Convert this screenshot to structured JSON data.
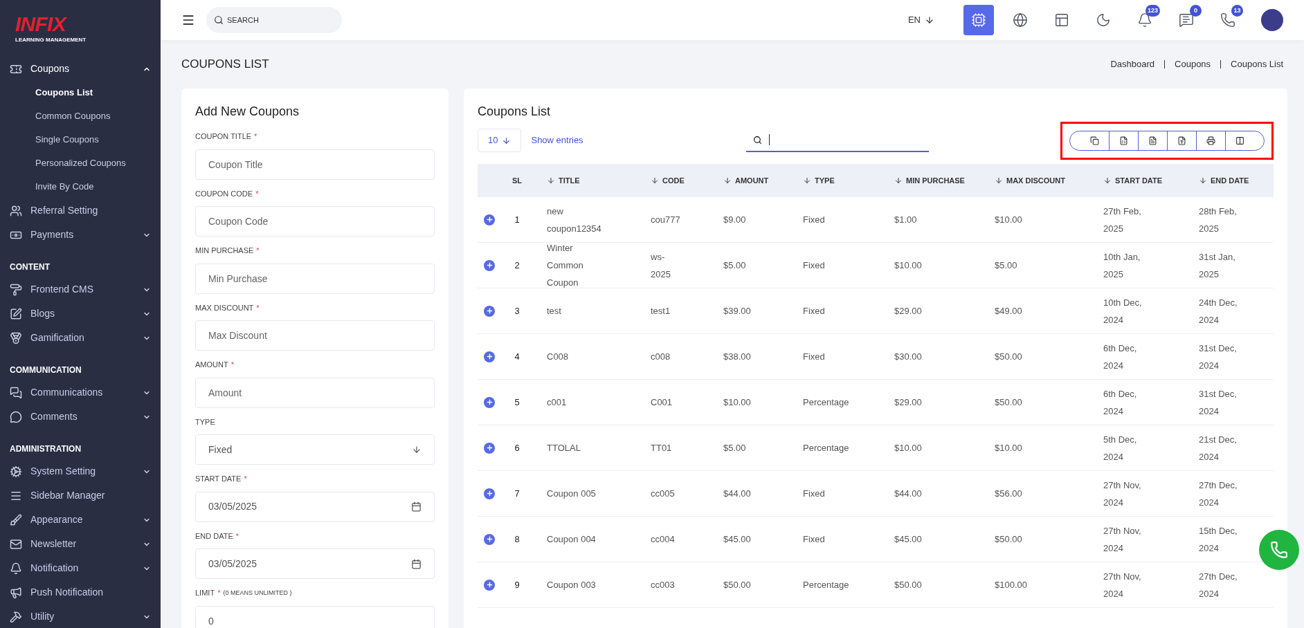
{
  "logo": {
    "brand": "INFIX",
    "tagline": "LEARNING MANAGEMENT"
  },
  "sidebar": {
    "items": [
      {
        "kind": "item",
        "label": "Coupons",
        "caret": true,
        "expanded": true,
        "children": [
          {
            "label": "Coupons List",
            "selected": true
          },
          {
            "label": "Common Coupons",
            "selected": false
          },
          {
            "label": "Single Coupons",
            "selected": false
          },
          {
            "label": "Personalized Coupons",
            "selected": false
          },
          {
            "label": "Invite By Code",
            "selected": false
          }
        ]
      },
      {
        "kind": "item",
        "label": "Referral Setting",
        "caret": false,
        "expanded": false
      },
      {
        "kind": "item",
        "label": "Payments",
        "caret": true,
        "expanded": false
      },
      {
        "kind": "heading",
        "label": "CONTENT"
      },
      {
        "kind": "item",
        "label": "Frontend CMS",
        "caret": true,
        "expanded": false
      },
      {
        "kind": "item",
        "label": "Blogs",
        "caret": true,
        "expanded": false
      },
      {
        "kind": "item",
        "label": "Gamification",
        "caret": true,
        "expanded": false
      },
      {
        "kind": "heading",
        "label": "COMMUNICATION"
      },
      {
        "kind": "item",
        "label": "Communications",
        "caret": true,
        "expanded": false
      },
      {
        "kind": "item",
        "label": "Comments",
        "caret": true,
        "expanded": false
      },
      {
        "kind": "heading",
        "label": "ADMINISTRATION"
      },
      {
        "kind": "item",
        "label": "System Setting",
        "caret": true,
        "expanded": false
      },
      {
        "kind": "item",
        "label": "Sidebar Manager",
        "caret": false,
        "expanded": false
      },
      {
        "kind": "item",
        "label": "Appearance",
        "caret": true,
        "expanded": false
      },
      {
        "kind": "item",
        "label": "Newsletter",
        "caret": true,
        "expanded": false
      },
      {
        "kind": "item",
        "label": "Notification",
        "caret": true,
        "expanded": false
      },
      {
        "kind": "item",
        "label": "Push Notification",
        "caret": false,
        "expanded": false
      },
      {
        "kind": "item",
        "label": "Utility",
        "caret": true,
        "expanded": false
      }
    ]
  },
  "topbar": {
    "search": {
      "placeholder": "SEARCH"
    },
    "language": "EN",
    "actions": [
      {
        "kind": "ai",
        "selected": true
      },
      {
        "kind": "globe",
        "selected": false
      },
      {
        "kind": "layout",
        "selected": false
      },
      {
        "kind": "theme",
        "selected": false
      },
      {
        "kind": "notifications",
        "selected": false,
        "badge": "123"
      },
      {
        "kind": "messages",
        "selected": false,
        "badge": "0"
      },
      {
        "kind": "chat",
        "selected": false,
        "badge": "13"
      }
    ]
  },
  "page": {
    "title": "COUPONS LIST",
    "breadcrumb": [
      "Dashboard",
      "Coupons",
      "Coupons List"
    ]
  },
  "form": {
    "title": "Add New Coupons",
    "fields": [
      {
        "kind": "text",
        "label": "COUPON TITLE",
        "required_mark": "*",
        "placeholder": "Coupon Title"
      },
      {
        "kind": "text",
        "label": "COUPON CODE",
        "required_mark": "*",
        "placeholder": "Coupon Code"
      },
      {
        "kind": "text",
        "label": "MIN PURCHASE",
        "required_mark": "*",
        "placeholder": "Min Purchase"
      },
      {
        "kind": "text",
        "label": "MAX DISCOUNT",
        "required_mark": "*",
        "placeholder": "Max Discount"
      },
      {
        "kind": "text",
        "label": "AMOUNT",
        "required_mark": "*",
        "placeholder": "Amount"
      },
      {
        "kind": "select",
        "label": "TYPE",
        "value": "Fixed"
      },
      {
        "kind": "date",
        "label": "START DATE",
        "required_mark": "*",
        "value": "03/05/2025"
      },
      {
        "kind": "date",
        "label": "END DATE",
        "required_mark": "*",
        "value": "03/05/2025"
      },
      {
        "kind": "text",
        "label": "LIMIT",
        "required_mark": "*",
        "note": "(0 MEANS UNLIMITED )",
        "value": "0"
      }
    ]
  },
  "list": {
    "title": "Coupons List",
    "page_size": "10",
    "show_entries": "Show entries",
    "export_toolbar": {
      "highlighted": true
    },
    "table": {
      "columns": [
        {
          "label": "SL",
          "sortable": false
        },
        {
          "label": "TITLE",
          "sortable": true
        },
        {
          "label": "CODE",
          "sortable": true
        },
        {
          "label": "AMOUNT",
          "sortable": true
        },
        {
          "label": "TYPE",
          "sortable": true
        },
        {
          "label": "MIN PURCHASE",
          "sortable": true
        },
        {
          "label": "MAX DISCOUNT",
          "sortable": true
        },
        {
          "label": "START DATE",
          "sortable": true
        },
        {
          "label": "END DATE",
          "sortable": true
        }
      ],
      "rows": [
        [
          "1",
          "new coupon12354",
          "cou777",
          "$9.00",
          "Fixed",
          "$1.00",
          "$10.00",
          "27th Feb, 2025",
          "28th Feb, 2025"
        ],
        [
          "2",
          "Winter Common Coupon",
          "ws-2025",
          "$5.00",
          "Fixed",
          "$10.00",
          "$5.00",
          "10th Jan, 2025",
          "31st Jan, 2025"
        ],
        [
          "3",
          "test",
          "test1",
          "$39.00",
          "Fixed",
          "$29.00",
          "$49.00",
          "10th Dec, 2024",
          "24th Dec, 2024"
        ],
        [
          "4",
          "C008",
          "c008",
          "$38.00",
          "Fixed",
          "$30.00",
          "$50.00",
          "6th Dec, 2024",
          "31st Dec, 2024"
        ],
        [
          "5",
          "c001",
          "C001",
          "$10.00",
          "Percentage",
          "$29.00",
          "$50.00",
          "6th Dec, 2024",
          "31st Dec, 2024"
        ],
        [
          "6",
          "TTOLAL",
          "TT01",
          "$5.00",
          "Percentage",
          "$10.00",
          "$10.00",
          "5th Dec, 2024",
          "21st Dec, 2024"
        ],
        [
          "7",
          "Coupon 005",
          "cc005",
          "$44.00",
          "Fixed",
          "$44.00",
          "$56.00",
          "27th Nov, 2024",
          "27th Dec, 2024"
        ],
        [
          "8",
          "Coupon 004",
          "cc004",
          "$45.00",
          "Fixed",
          "$45.00",
          "$50.00",
          "27th Nov, 2024",
          "15th Dec, 2024"
        ],
        [
          "9",
          "Coupon 003",
          "cc003",
          "$50.00",
          "Percentage",
          "$50.00",
          "$100.00",
          "27th Nov, 2024",
          "27th Dec, 2024"
        ]
      ]
    }
  }
}
